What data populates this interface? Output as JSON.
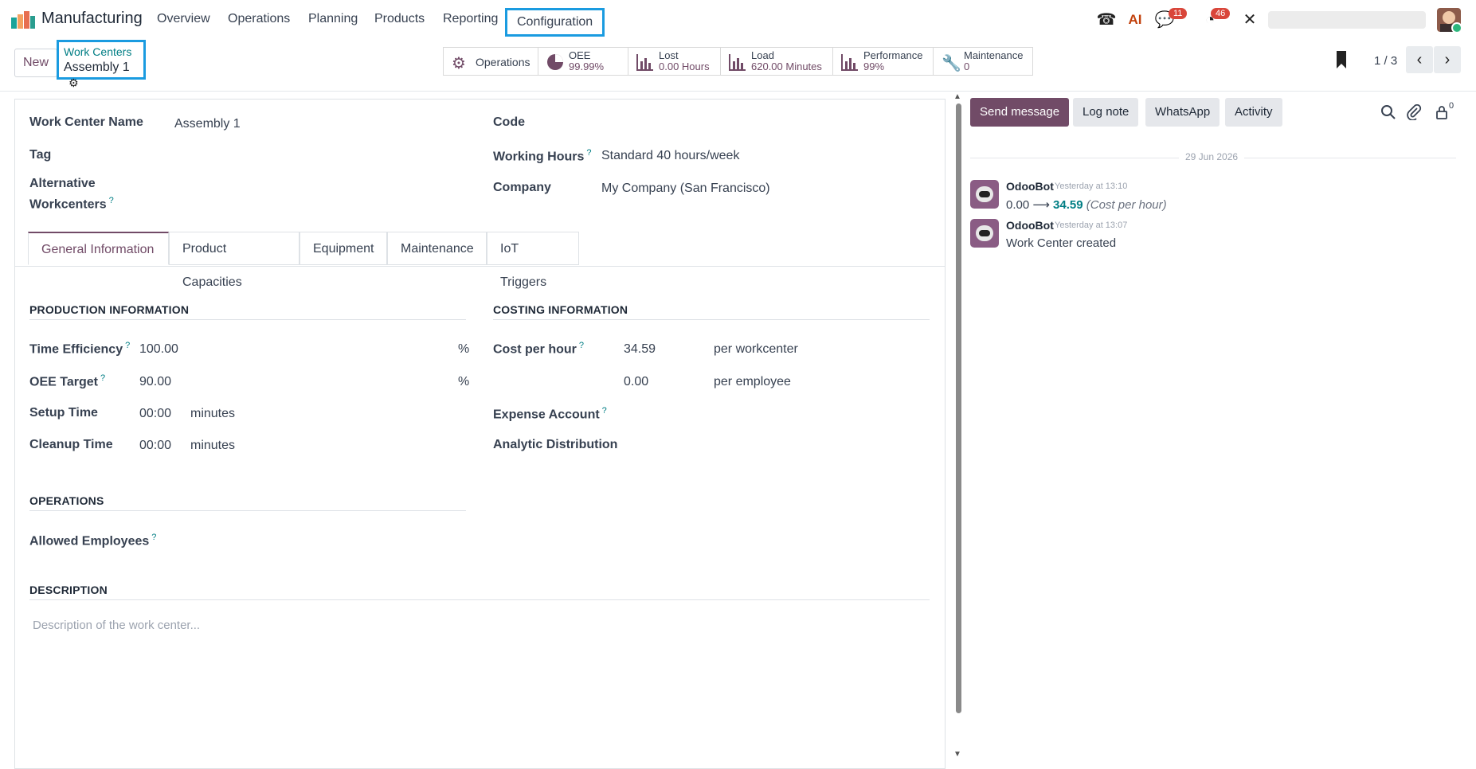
{
  "navbar": {
    "app_name": "Manufacturing",
    "menus": [
      "Overview",
      "Operations",
      "Planning",
      "Products",
      "Reporting",
      "Configuration"
    ],
    "messages_badge": "11",
    "activity_badge": "46",
    "icons": [
      "phone-icon",
      "ai-icon",
      "chat-icon",
      "clock-icon",
      "tools-icon"
    ]
  },
  "control": {
    "new_label": "New",
    "breadcrumb_parent": "Work Centers",
    "breadcrumb_current": "Assembly 1",
    "pager": "1 / 3",
    "smart_buttons": [
      {
        "label": "Operations",
        "value": ""
      },
      {
        "label": "OEE",
        "value": "99.99%"
      },
      {
        "label": "Lost",
        "value": "0.00 Hours"
      },
      {
        "label": "Load",
        "value": "620.00 Minutes"
      },
      {
        "label": "Performance",
        "value": "99%"
      },
      {
        "label": "Maintenance",
        "value": "0"
      }
    ]
  },
  "form": {
    "work_center_name_label": "Work Center Name",
    "work_center_name": "Assembly 1",
    "tag_label": "Tag",
    "alt_label_1": "Alternative",
    "alt_label_2": "Workcenters",
    "code_label": "Code",
    "working_hours_label": "Working Hours",
    "working_hours": "Standard 40 hours/week",
    "company_label": "Company",
    "company": "My Company (San Francisco)",
    "tabs": [
      "General Information",
      "Product Capacities",
      "Equipment",
      "Maintenance",
      "IoT Triggers"
    ],
    "production": {
      "title": "PRODUCTION INFORMATION",
      "time_efficiency_label": "Time Efficiency",
      "time_efficiency": "100.00",
      "oee_target_label": "OEE Target",
      "oee_target": "90.00",
      "percent": "%",
      "setup_label": "Setup Time",
      "setup": "00:00",
      "cleanup_label": "Cleanup Time",
      "cleanup": "00:00",
      "minutes": "minutes"
    },
    "costing": {
      "title": "COSTING INFORMATION",
      "cost_per_hour_label": "Cost per hour",
      "cost_per_hour": "34.59",
      "per_workcenter": "per workcenter",
      "employee_cost": "0.00",
      "per_employee": "per employee",
      "expense_account_label": "Expense Account",
      "analytic_label": "Analytic Distribution"
    },
    "operations": {
      "title": "OPERATIONS",
      "allowed_employees_label": "Allowed Employees"
    },
    "description": {
      "title": "DESCRIPTION",
      "placeholder": "Description of the work center..."
    }
  },
  "chatter": {
    "send_message": "Send message",
    "log_note": "Log note",
    "whatsapp": "WhatsApp",
    "activity": "Activity",
    "followers_count": "0",
    "date_separator": "29 Jun 2026",
    "messages": [
      {
        "author": "OdooBot",
        "time": "Yesterday at 13:10",
        "old": "0.00",
        "new": "34.59",
        "field": "(Cost per hour)"
      },
      {
        "author": "OdooBot",
        "time": "Yesterday at 13:07",
        "body": "Work Center created"
      }
    ]
  },
  "colors": {
    "brand": "#714b67",
    "accent": "#017e84",
    "highlight": "#1a9be0",
    "badge": "#d9463a"
  }
}
